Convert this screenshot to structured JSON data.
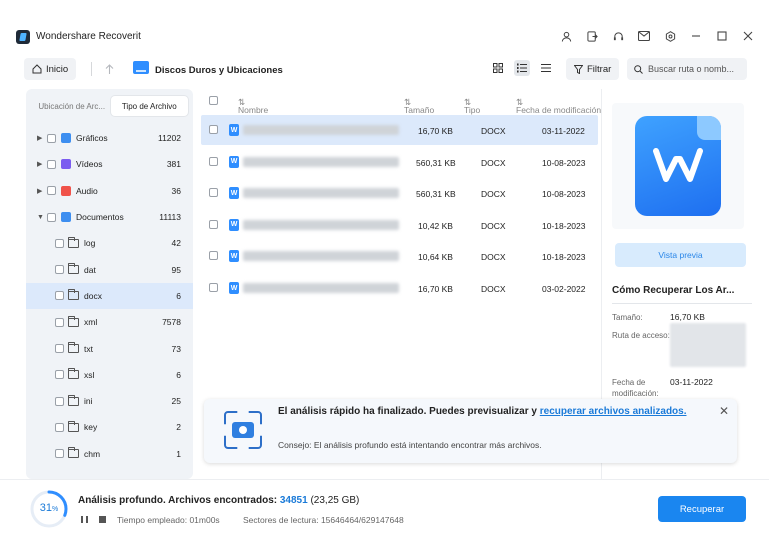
{
  "app": {
    "title": "Wondershare Recoverit",
    "window_icons": [
      "user-icon",
      "signout-icon",
      "headset-icon",
      "mail-icon",
      "gear-icon",
      "minimize-icon",
      "maximize-icon",
      "close-icon"
    ]
  },
  "toolbar": {
    "home_label": "Inicio",
    "location_title": "Discos Duros y Ubicaciones",
    "filter_label": "Filtrar",
    "search_placeholder": "Buscar ruta o nomb..."
  },
  "sidebar": {
    "tabs": [
      {
        "label": "Ubicación de Arc...",
        "active": false
      },
      {
        "label": "Tipo de Archivo",
        "active": true
      }
    ],
    "categories": [
      {
        "label": "Gráficos",
        "count": "11202",
        "icon": "image-icon",
        "color": "#3d8ef0"
      },
      {
        "label": "Vídeos",
        "count": "381",
        "icon": "video-icon",
        "color": "#7b5cf0"
      },
      {
        "label": "Audio",
        "count": "36",
        "icon": "audio-icon",
        "color": "#f0524a"
      },
      {
        "label": "Documentos",
        "count": "11113",
        "icon": "document-icon",
        "color": "#3d8ef0"
      }
    ],
    "folders": [
      {
        "label": "log",
        "count": "42",
        "selected": false
      },
      {
        "label": "dat",
        "count": "95",
        "selected": false
      },
      {
        "label": "docx",
        "count": "6",
        "selected": true
      },
      {
        "label": "xml",
        "count": "7578",
        "selected": false
      },
      {
        "label": "txt",
        "count": "73",
        "selected": false
      },
      {
        "label": "xsl",
        "count": "6",
        "selected": false
      },
      {
        "label": "ini",
        "count": "25",
        "selected": false
      },
      {
        "label": "key",
        "count": "2",
        "selected": false
      },
      {
        "label": "chm",
        "count": "1",
        "selected": false
      }
    ]
  },
  "filelist": {
    "columns": {
      "name": "Nombre",
      "size": "Tamaño",
      "type": "Tipo",
      "modified": "Fecha de modificación"
    },
    "rows": [
      {
        "size": "16,70 KB",
        "type": "DOCX",
        "date": "03-11-2022",
        "selected": true
      },
      {
        "size": "560,31 KB",
        "type": "DOCX",
        "date": "10-08-2023",
        "selected": false
      },
      {
        "size": "560,31 KB",
        "type": "DOCX",
        "date": "10-08-2023",
        "selected": false
      },
      {
        "size": "10,42 KB",
        "type": "DOCX",
        "date": "10-18-2023",
        "selected": false
      },
      {
        "size": "10,64 KB",
        "type": "DOCX",
        "date": "10-18-2023",
        "selected": false
      },
      {
        "size": "16,70 KB",
        "type": "DOCX",
        "date": "03-02-2022",
        "selected": false
      }
    ]
  },
  "preview": {
    "button_label": "Vista previa",
    "title": "Cómo Recuperar Los Ar...",
    "size_label": "Tamaño:",
    "size_value": "16,70 KB",
    "path_label": "Ruta de acceso:",
    "date_label": "Fecha de modificación:",
    "date_value": "03-11-2022"
  },
  "toast": {
    "title": "El análisis rápido ha finalizado. Puedes previsualizar y ",
    "link": "recuperar archivos analizados.",
    "tip": "Consejo: El análisis profundo está intentando encontrar más archivos."
  },
  "footer": {
    "progress_percent": 31,
    "progress_text": "31",
    "progress_unit": "%",
    "scan_label": "Análisis profundo. Archivos encontrados: ",
    "found_count": "34851",
    "found_size": " (23,25 GB)",
    "time_label": "Tiempo empleado: 01m00s",
    "sectors_label": "Sectores de lectura: 15646464/629147648",
    "recover_label": "Recuperar"
  }
}
